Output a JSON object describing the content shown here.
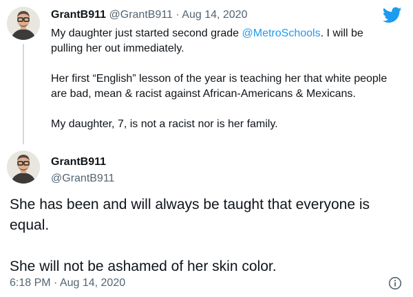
{
  "parent_tweet": {
    "display_name": "GrantB911",
    "handle": "@GrantB911",
    "separator": "·",
    "date": "Aug 14, 2020",
    "avatar_icon": "profile-photo",
    "text_before_mention": "My daughter just started second grade ",
    "mention": "@MetroSchools",
    "text_after_mention": ". I will be pulling her out immediately.",
    "paragraph_2": "Her first “English” lesson of the year is teaching her that white people are bad, mean & racist against African-Americans & Mexicans.",
    "paragraph_3": "My daughter, 7, is not a racist nor is her family."
  },
  "main_tweet": {
    "display_name": "GrantB911",
    "handle": "@GrantB911",
    "avatar_icon": "profile-photo",
    "paragraph_1": "She has been and will always be taught that everyone is equal.",
    "paragraph_2": "She will not be ashamed of her skin color.",
    "timestamp": "6:18 PM · Aug 14, 2020"
  },
  "icons": {
    "brand": "twitter-bird-icon",
    "info": "info-icon"
  },
  "colors": {
    "accent": "#1d9bf0",
    "secondary_text": "#536471",
    "primary_text": "#0f1419",
    "thread_line": "#cfd9de"
  }
}
